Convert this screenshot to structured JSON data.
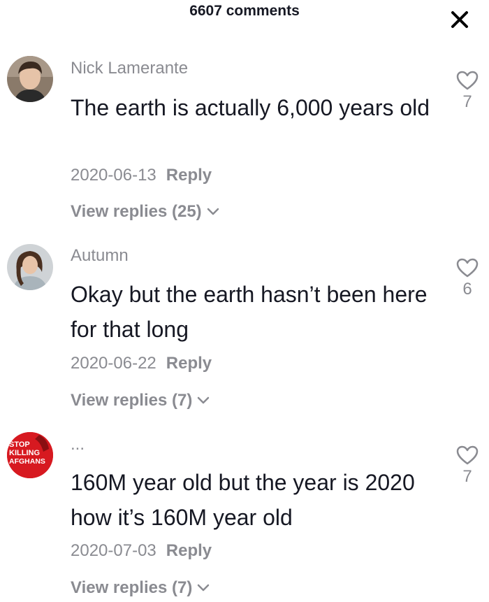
{
  "header": {
    "title": "6607 comments",
    "close_icon": "close-icon"
  },
  "comments": [
    {
      "username": "Nick Lamerante",
      "text": "The earth is actually 6,000 years old",
      "date": "2020-06-13",
      "reply_label": "Reply",
      "view_replies": "View replies (25)",
      "likes": "7"
    },
    {
      "username": "Autumn",
      "text": "Okay but the earth hasn’t been here for that long",
      "date": "2020-06-22",
      "reply_label": "Reply",
      "view_replies": "View replies (7)",
      "likes": "6"
    },
    {
      "username": "...",
      "avatar_text": "STOP KILLING AFGHANS",
      "text": "160M year old but the year is 2020 how it’s 160M year old",
      "date": "2020-07-03",
      "reply_label": "Reply",
      "view_replies": "View replies (7)",
      "likes": "7"
    }
  ],
  "colors": {
    "text": "#161823",
    "muted": "#8a8b91",
    "avatar3_bg": "#d71920"
  }
}
